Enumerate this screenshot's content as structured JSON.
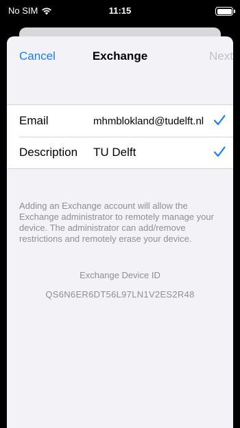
{
  "status_bar": {
    "carrier": "No SIM",
    "time": "11:15",
    "wifi_icon": "wifi-icon",
    "battery_icon": "battery-icon"
  },
  "navbar": {
    "cancel_label": "Cancel",
    "title": "Exchange",
    "next_label": "Next"
  },
  "form": {
    "rows": [
      {
        "label": "Email",
        "value": "mhmblokland@tudelft.nl",
        "icon": "checkmark-icon"
      },
      {
        "label": "Description",
        "value": "TU Delft",
        "icon": "checkmark-icon"
      }
    ]
  },
  "footer": {
    "info": "Adding an Exchange account will allow the Exchange administrator to remotely manage your device. The administrator can add/remove restrictions and remotely erase your device.",
    "device_id_label": "Exchange Device ID",
    "device_id": "QS6N6ER6DT56L97LN1V2ES2R48"
  },
  "colors": {
    "accent": "#147efb",
    "disabled": "#c0c0c5",
    "secondary_text": "#8e8e93",
    "background": "#f2f2f7"
  }
}
